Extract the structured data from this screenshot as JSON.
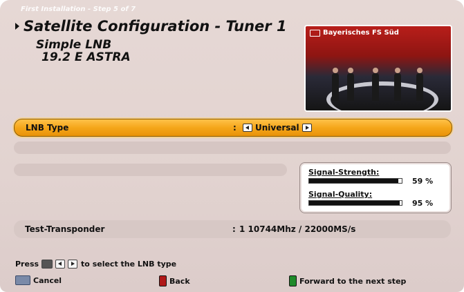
{
  "header": {
    "step": "First Installation - Step 5 of 7",
    "title": "Satellite Configuration - Tuner 1",
    "lnb_line1": "Simple LNB",
    "lnb_line2": "19.2 E ASTRA"
  },
  "preview": {
    "channel": "Bayerisches FS Süd",
    "icon": "tv-icon"
  },
  "settings": {
    "lnb_type": {
      "label": "LNB Type",
      "colon": ":",
      "value": "Universal"
    },
    "transponder": {
      "label": "Test-Transponder",
      "colon": ":",
      "value": "1  10744Mhz / 22000MS/s"
    }
  },
  "signal": {
    "strength_label": "Signal-Strength:",
    "strength_value": "59 %",
    "strength_level": 0.96,
    "quality_label": "Signal-Quality:",
    "quality_value": "95 %",
    "quality_level": 0.98
  },
  "footer": {
    "hint_prefix": "Press",
    "hint_suffix": "to select the LNB type",
    "cancel": "Cancel",
    "back": "Back",
    "forward": "Forward to the next step"
  },
  "colors": {
    "highlight": "#f5a61a",
    "back_key": "#b01818",
    "forward_key": "#1f8a2a"
  }
}
